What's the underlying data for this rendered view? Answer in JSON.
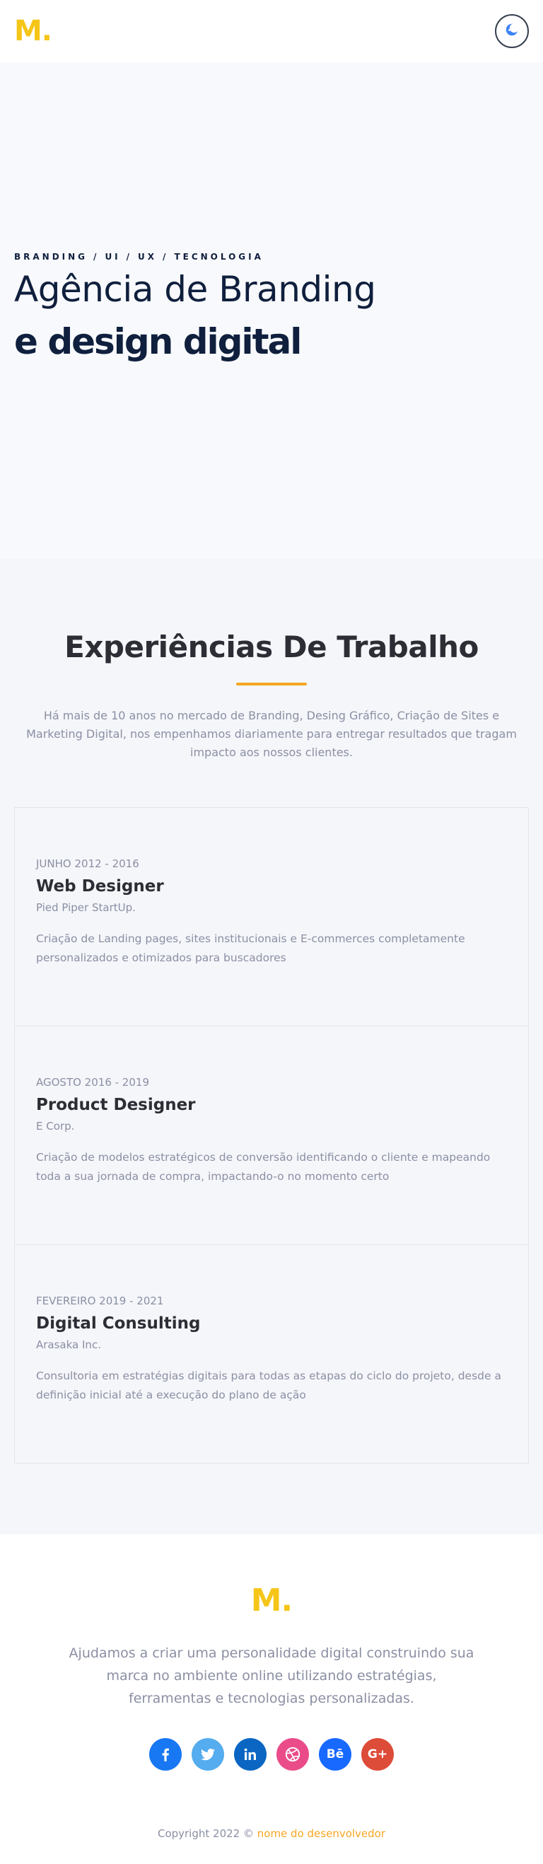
{
  "header": {
    "logo": "M.",
    "theme_toggle_icon": "moon-icon"
  },
  "hero": {
    "tags": [
      "BRANDING",
      "UI",
      "UX",
      "TECNOLOGIA"
    ],
    "tag_separator": "/",
    "title_line1": "Agência de Branding",
    "title_line2": "e design digital"
  },
  "experience": {
    "title": "Experiências De Trabalho",
    "intro": "Há mais de 10 anos no mercado de Branding, Desing Gráfico, Criação de Sites e Marketing Digital, nos empenhamos diariamente para entregar resultados que tragam impacto aos nossos clientes.",
    "items": [
      {
        "date": "JUNHO 2012 - 2016",
        "role": "Web Designer",
        "company": "Pied Piper StartUp.",
        "description": "Criação de Landing pages, sites institucionais e E-commerces completamente personalizados e otimizados para buscadores"
      },
      {
        "date": "AGOSTO 2016 - 2019",
        "role": "Product Designer",
        "company": "E Corp.",
        "description": "Criação de modelos estratégicos de conversão identificando o cliente e mapeando toda a sua jornada de compra, impactando-o no momento certo"
      },
      {
        "date": "FEVEREIRO 2019 - 2021",
        "role": "Digital Consulting",
        "company": "Arasaka Inc.",
        "description": "Consultoria em estratégias digitais para todas as etapas do ciclo do projeto, desde a definição inicial até a execução do plano de ação"
      }
    ]
  },
  "footer": {
    "logo": "M.",
    "text": "Ajudamos a criar uma personalidade digital construindo sua marca no ambiente online utilizando estratégias, ferramentas e tecnologias personalizadas.",
    "social": [
      {
        "name": "facebook-icon",
        "color": "#1877f2"
      },
      {
        "name": "twitter-icon",
        "color": "#55acee"
      },
      {
        "name": "linkedin-icon",
        "color": "#0a66c2"
      },
      {
        "name": "dribbble-icon",
        "color": "#ea4c89"
      },
      {
        "name": "behance-icon",
        "color": "#1769ff",
        "label": "Bē"
      },
      {
        "name": "google-plus-icon",
        "color": "#dd4b39",
        "label": "G+"
      }
    ],
    "copyright_prefix": "Copyright 2022 ©",
    "copyright_dev": "nome do desenvolvedor"
  },
  "colors": {
    "accent_yellow": "#f5c518",
    "accent_orange": "#f5a623",
    "navy": "#0f1f3d"
  }
}
